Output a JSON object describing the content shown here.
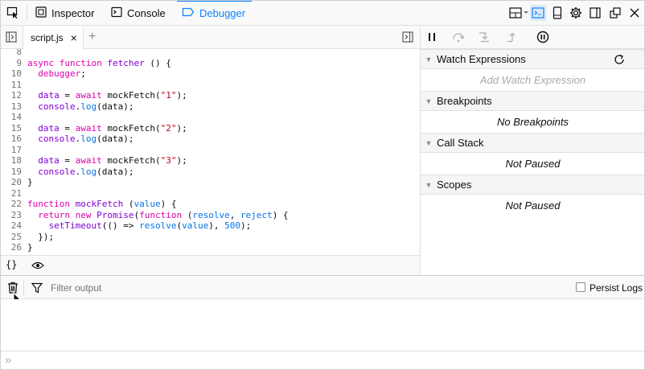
{
  "toolbar": {
    "picker_icon": "element-picker-icon",
    "tabs": [
      {
        "label": "Inspector",
        "icon": "inspector-icon"
      },
      {
        "label": "Console",
        "icon": "console-icon"
      },
      {
        "label": "Debugger",
        "icon": "debugger-icon",
        "selected": true
      }
    ],
    "right_icons": [
      "layout-icon",
      "split-console-icon",
      "responsive-design-icon",
      "settings-icon",
      "dock-side-icon",
      "separate-window-icon",
      "close-icon"
    ]
  },
  "sources": {
    "tab_label": "script.js",
    "close_glyph": "×",
    "add_glyph": "+"
  },
  "editor": {
    "lines": [
      {
        "n": "8",
        "tokens": []
      },
      {
        "n": "9",
        "tokens": [
          [
            "kw",
            "async "
          ],
          [
            "kw",
            "function "
          ],
          [
            "fn",
            "fetcher "
          ],
          [
            "nm",
            "() {"
          ]
        ]
      },
      {
        "n": "10",
        "tokens": [
          [
            "nm",
            "  "
          ],
          [
            "kw",
            "debugger"
          ],
          [
            "nm",
            ";"
          ]
        ]
      },
      {
        "n": "11",
        "tokens": []
      },
      {
        "n": "12",
        "tokens": [
          [
            "nm",
            "  "
          ],
          [
            "fn",
            "data"
          ],
          [
            "nm",
            " = "
          ],
          [
            "kw",
            "await "
          ],
          [
            "nm",
            "mockFetch("
          ],
          [
            "st",
            "\"1\""
          ],
          [
            "nm",
            ");"
          ]
        ]
      },
      {
        "n": "13",
        "tokens": [
          [
            "nm",
            "  "
          ],
          [
            "fn",
            "console"
          ],
          [
            "nm",
            "."
          ],
          [
            "pr",
            "log"
          ],
          [
            "nm",
            "(data);"
          ]
        ]
      },
      {
        "n": "14",
        "tokens": []
      },
      {
        "n": "15",
        "tokens": [
          [
            "nm",
            "  "
          ],
          [
            "fn",
            "data"
          ],
          [
            "nm",
            " = "
          ],
          [
            "kw",
            "await "
          ],
          [
            "nm",
            "mockFetch("
          ],
          [
            "st",
            "\"2\""
          ],
          [
            "nm",
            ");"
          ]
        ]
      },
      {
        "n": "16",
        "tokens": [
          [
            "nm",
            "  "
          ],
          [
            "fn",
            "console"
          ],
          [
            "nm",
            "."
          ],
          [
            "pr",
            "log"
          ],
          [
            "nm",
            "(data);"
          ]
        ]
      },
      {
        "n": "17",
        "tokens": []
      },
      {
        "n": "18",
        "tokens": [
          [
            "nm",
            "  "
          ],
          [
            "fn",
            "data"
          ],
          [
            "nm",
            " = "
          ],
          [
            "kw",
            "await "
          ],
          [
            "nm",
            "mockFetch("
          ],
          [
            "st",
            "\"3\""
          ],
          [
            "nm",
            ");"
          ]
        ]
      },
      {
        "n": "19",
        "tokens": [
          [
            "nm",
            "  "
          ],
          [
            "fn",
            "console"
          ],
          [
            "nm",
            "."
          ],
          [
            "pr",
            "log"
          ],
          [
            "nm",
            "(data);"
          ]
        ]
      },
      {
        "n": "20",
        "tokens": [
          [
            "nm",
            "}"
          ]
        ]
      },
      {
        "n": "21",
        "tokens": []
      },
      {
        "n": "22",
        "tokens": [
          [
            "kw",
            "function "
          ],
          [
            "fn",
            "mockFetch "
          ],
          [
            "nm",
            "("
          ],
          [
            "pr",
            "value"
          ],
          [
            "nm",
            ") {"
          ]
        ]
      },
      {
        "n": "23",
        "tokens": [
          [
            "nm",
            "  "
          ],
          [
            "kw",
            "return "
          ],
          [
            "kw",
            "new "
          ],
          [
            "fn",
            "Promise"
          ],
          [
            "nm",
            "("
          ],
          [
            "kw",
            "function "
          ],
          [
            "nm",
            "("
          ],
          [
            "pr",
            "resolve"
          ],
          [
            "nm",
            ", "
          ],
          [
            "pr",
            "reject"
          ],
          [
            "nm",
            ") {"
          ]
        ]
      },
      {
        "n": "24",
        "tokens": [
          [
            "nm",
            "    "
          ],
          [
            "fn",
            "setTimeout"
          ],
          [
            "nm",
            "(() => "
          ],
          [
            "pr",
            "resolve"
          ],
          [
            "nm",
            "("
          ],
          [
            "pr",
            "value"
          ],
          [
            "nm",
            "), "
          ],
          [
            "num",
            "500"
          ],
          [
            "nm",
            ");"
          ]
        ]
      },
      {
        "n": "25",
        "tokens": [
          [
            "nm",
            "  });"
          ]
        ]
      },
      {
        "n": "26",
        "tokens": [
          [
            "nm",
            "}"
          ]
        ]
      }
    ],
    "footer_icons": [
      "pretty-print-icon",
      "eye-icon"
    ],
    "footer_pretty_glyph": "{}"
  },
  "debugger": {
    "command_icons": [
      "pause-icon",
      "step-over-icon",
      "step-in-icon",
      "step-out-icon",
      "pause-on-exceptions-icon"
    ],
    "panes": {
      "watch": {
        "title": "Watch Expressions",
        "placeholder": "Add Watch Expression",
        "refresh_icon": "refresh-icon"
      },
      "breakpoints": {
        "title": "Breakpoints",
        "body": "No Breakpoints"
      },
      "callstack": {
        "title": "Call Stack",
        "body": "Not Paused"
      },
      "scopes": {
        "title": "Scopes",
        "body": "Not Paused"
      }
    }
  },
  "console": {
    "trash_icon": "trash-icon",
    "filter_icon": "filter-icon",
    "filter_placeholder": "Filter output",
    "persist_label": "Persist Logs",
    "prompt_glyph": "»"
  }
}
